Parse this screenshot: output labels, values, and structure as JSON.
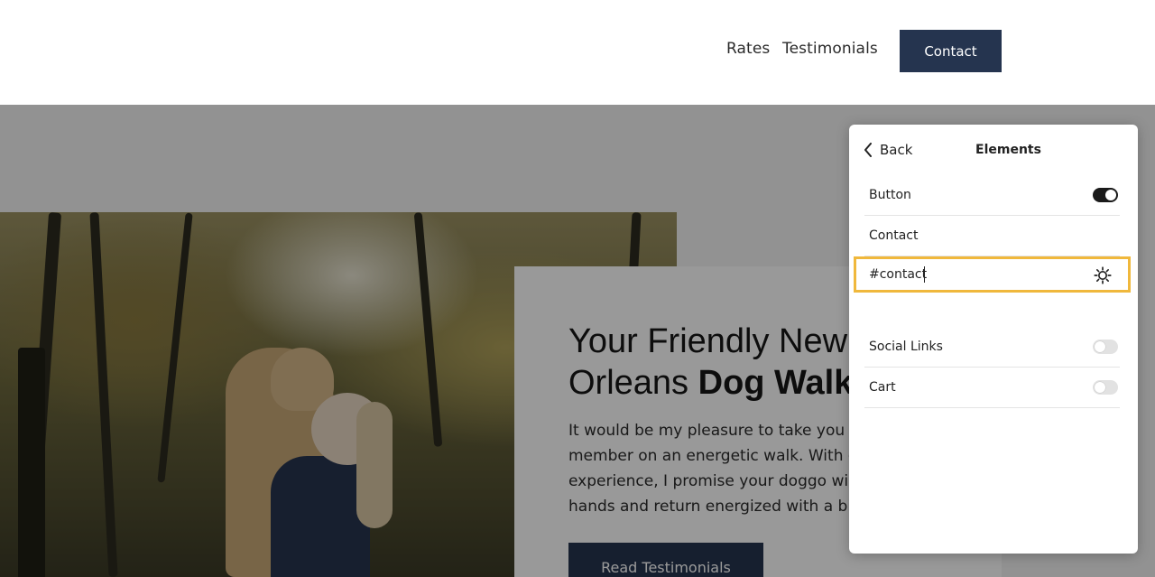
{
  "header": {
    "nav": [
      "Rates",
      "Testimonials"
    ],
    "contact_label": "Contact"
  },
  "hero": {
    "title_line1": "Your Friendly New",
    "title_line2_regular": "Orleans ",
    "title_line2_bold": "Dog Walk",
    "description_lines": [
      "It would be my pleasure to take you fury",
      "member on an energetic walk. With ove",
      "experience, I promise your doggo will be",
      "hands and return energized with a big s"
    ],
    "button_label": "Read Testimonials"
  },
  "panel": {
    "back_label": "Back",
    "title": "Elements",
    "rows": [
      {
        "label": "Button",
        "toggle": "on"
      },
      {
        "label": "Contact"
      },
      {
        "label": "Social Links",
        "toggle": "off"
      },
      {
        "label": "Cart",
        "toggle": "off"
      }
    ],
    "link_value": "#contact",
    "highlight_color": "#f0b83c"
  },
  "colors": {
    "accent": "#25344f"
  },
  "icons": {
    "back": "chevron-left-icon",
    "link_settings": "gear-icon"
  }
}
